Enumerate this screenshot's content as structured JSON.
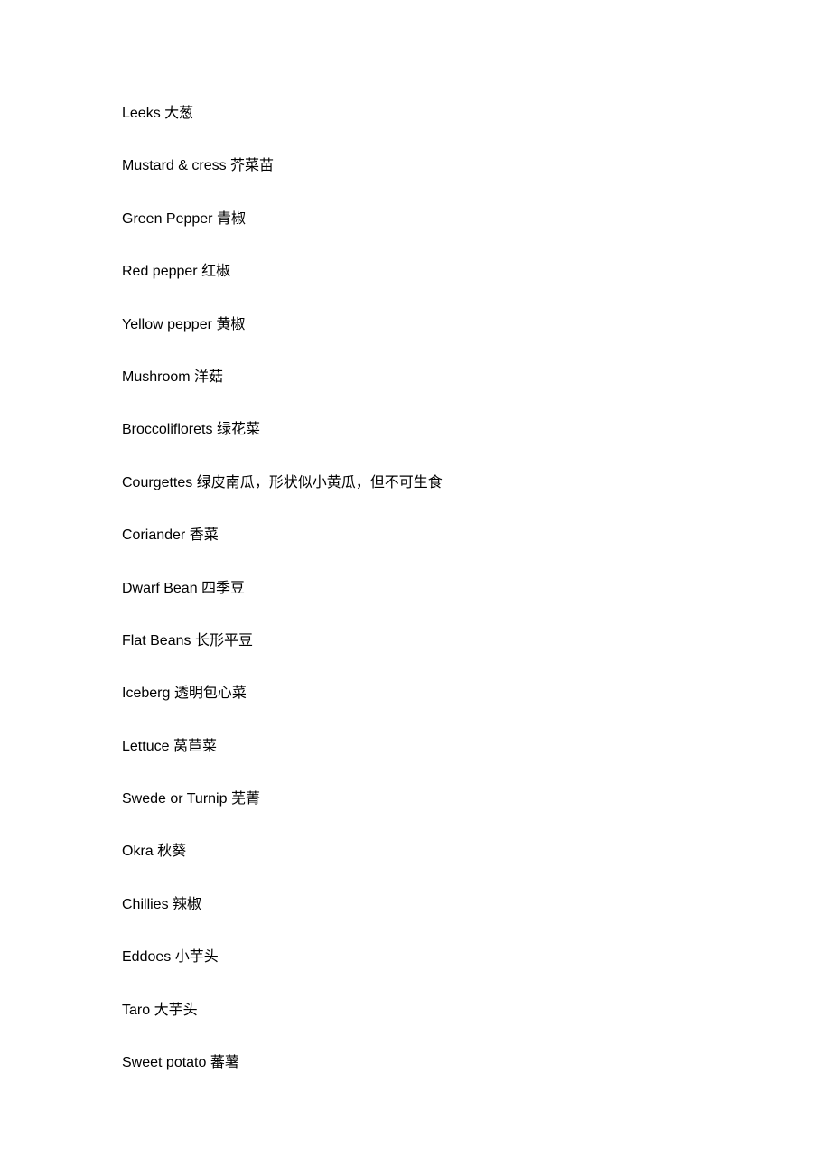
{
  "vocabulary": [
    {
      "english": "Leeks",
      "chinese": "大葱"
    },
    {
      "english": "Mustard & cress",
      "chinese": "芥菜苗"
    },
    {
      "english": "Green Pepper",
      "chinese": "青椒"
    },
    {
      "english": "Red pepper",
      "chinese": "红椒"
    },
    {
      "english": "Yellow pepper",
      "chinese": "黄椒"
    },
    {
      "english": "Mushroom",
      "chinese": "洋菇"
    },
    {
      "english": "Broccoliflorets",
      "chinese": "绿花菜"
    },
    {
      "english": "Courgettes",
      "chinese": "绿皮南瓜，形状似小黄瓜，但不可生食"
    },
    {
      "english": "Coriander",
      "chinese": "香菜"
    },
    {
      "english": "Dwarf Bean",
      "chinese": "四季豆"
    },
    {
      "english": "Flat Beans",
      "chinese": "长形平豆"
    },
    {
      "english": "Iceberg",
      "chinese": "透明包心菜"
    },
    {
      "english": "Lettuce",
      "chinese": "莴苣菜"
    },
    {
      "english": "Swede or Turnip",
      "chinese": "芜菁"
    },
    {
      "english": "Okra",
      "chinese": "秋葵"
    },
    {
      "english": "Chillies",
      "chinese": "辣椒"
    },
    {
      "english": "Eddoes",
      "chinese": "小芋头"
    },
    {
      "english": "Taro",
      "chinese": "大芋头"
    },
    {
      "english": "Sweet potato",
      "chinese": "蕃薯"
    }
  ]
}
